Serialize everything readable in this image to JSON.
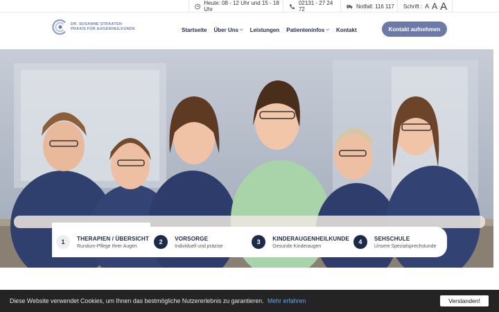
{
  "topbar": {
    "hours": "Heute: 08 - 12 Uhr und 15 - 18 Uhr",
    "phone": "02131 - 27 24 72",
    "emergency": "Notfall: 116 117",
    "font_label": "Schrift :",
    "font_sizes": [
      "A",
      "A",
      "A"
    ]
  },
  "logo": {
    "line1": "DR. SUSANNE STRAATEN",
    "line2": "PRAXIS FÜR AUGENHEILKUNDE"
  },
  "nav": {
    "items": [
      {
        "label": "Startseite"
      },
      {
        "label": "Über Uns"
      },
      {
        "label": "Leistungen"
      },
      {
        "label": "Patienteninfos"
      },
      {
        "label": "Kontakt"
      }
    ],
    "cta": "Kontakt aufnehmen"
  },
  "features": [
    {
      "num": "1",
      "title": "THERAPIEN / ÜBERSICHT",
      "subtitle": "Rundum-Pflege Ihrer Augen"
    },
    {
      "num": "2",
      "title": "VORSORGE",
      "subtitle": "Individuell und präzise"
    },
    {
      "num": "3",
      "title": "KINDERAUGENHEILKUNDE",
      "subtitle": "Gesunde Kinderaugen"
    },
    {
      "num": "4",
      "title": "SEHSCHULE",
      "subtitle": "Unsere Spezialsprechstunde"
    }
  ],
  "cookie": {
    "text": "Diese Website verwendet Cookies, um Ihnen das bestmögliche Nutzererlebnis zu garantieren.",
    "link": "Mehr erfahren",
    "button": "Verstanden!"
  },
  "colors": {
    "navy": "#1e2a4a",
    "accent": "#6b7aa8",
    "cookie_bg": "#242424",
    "link": "#6aa7e0"
  }
}
